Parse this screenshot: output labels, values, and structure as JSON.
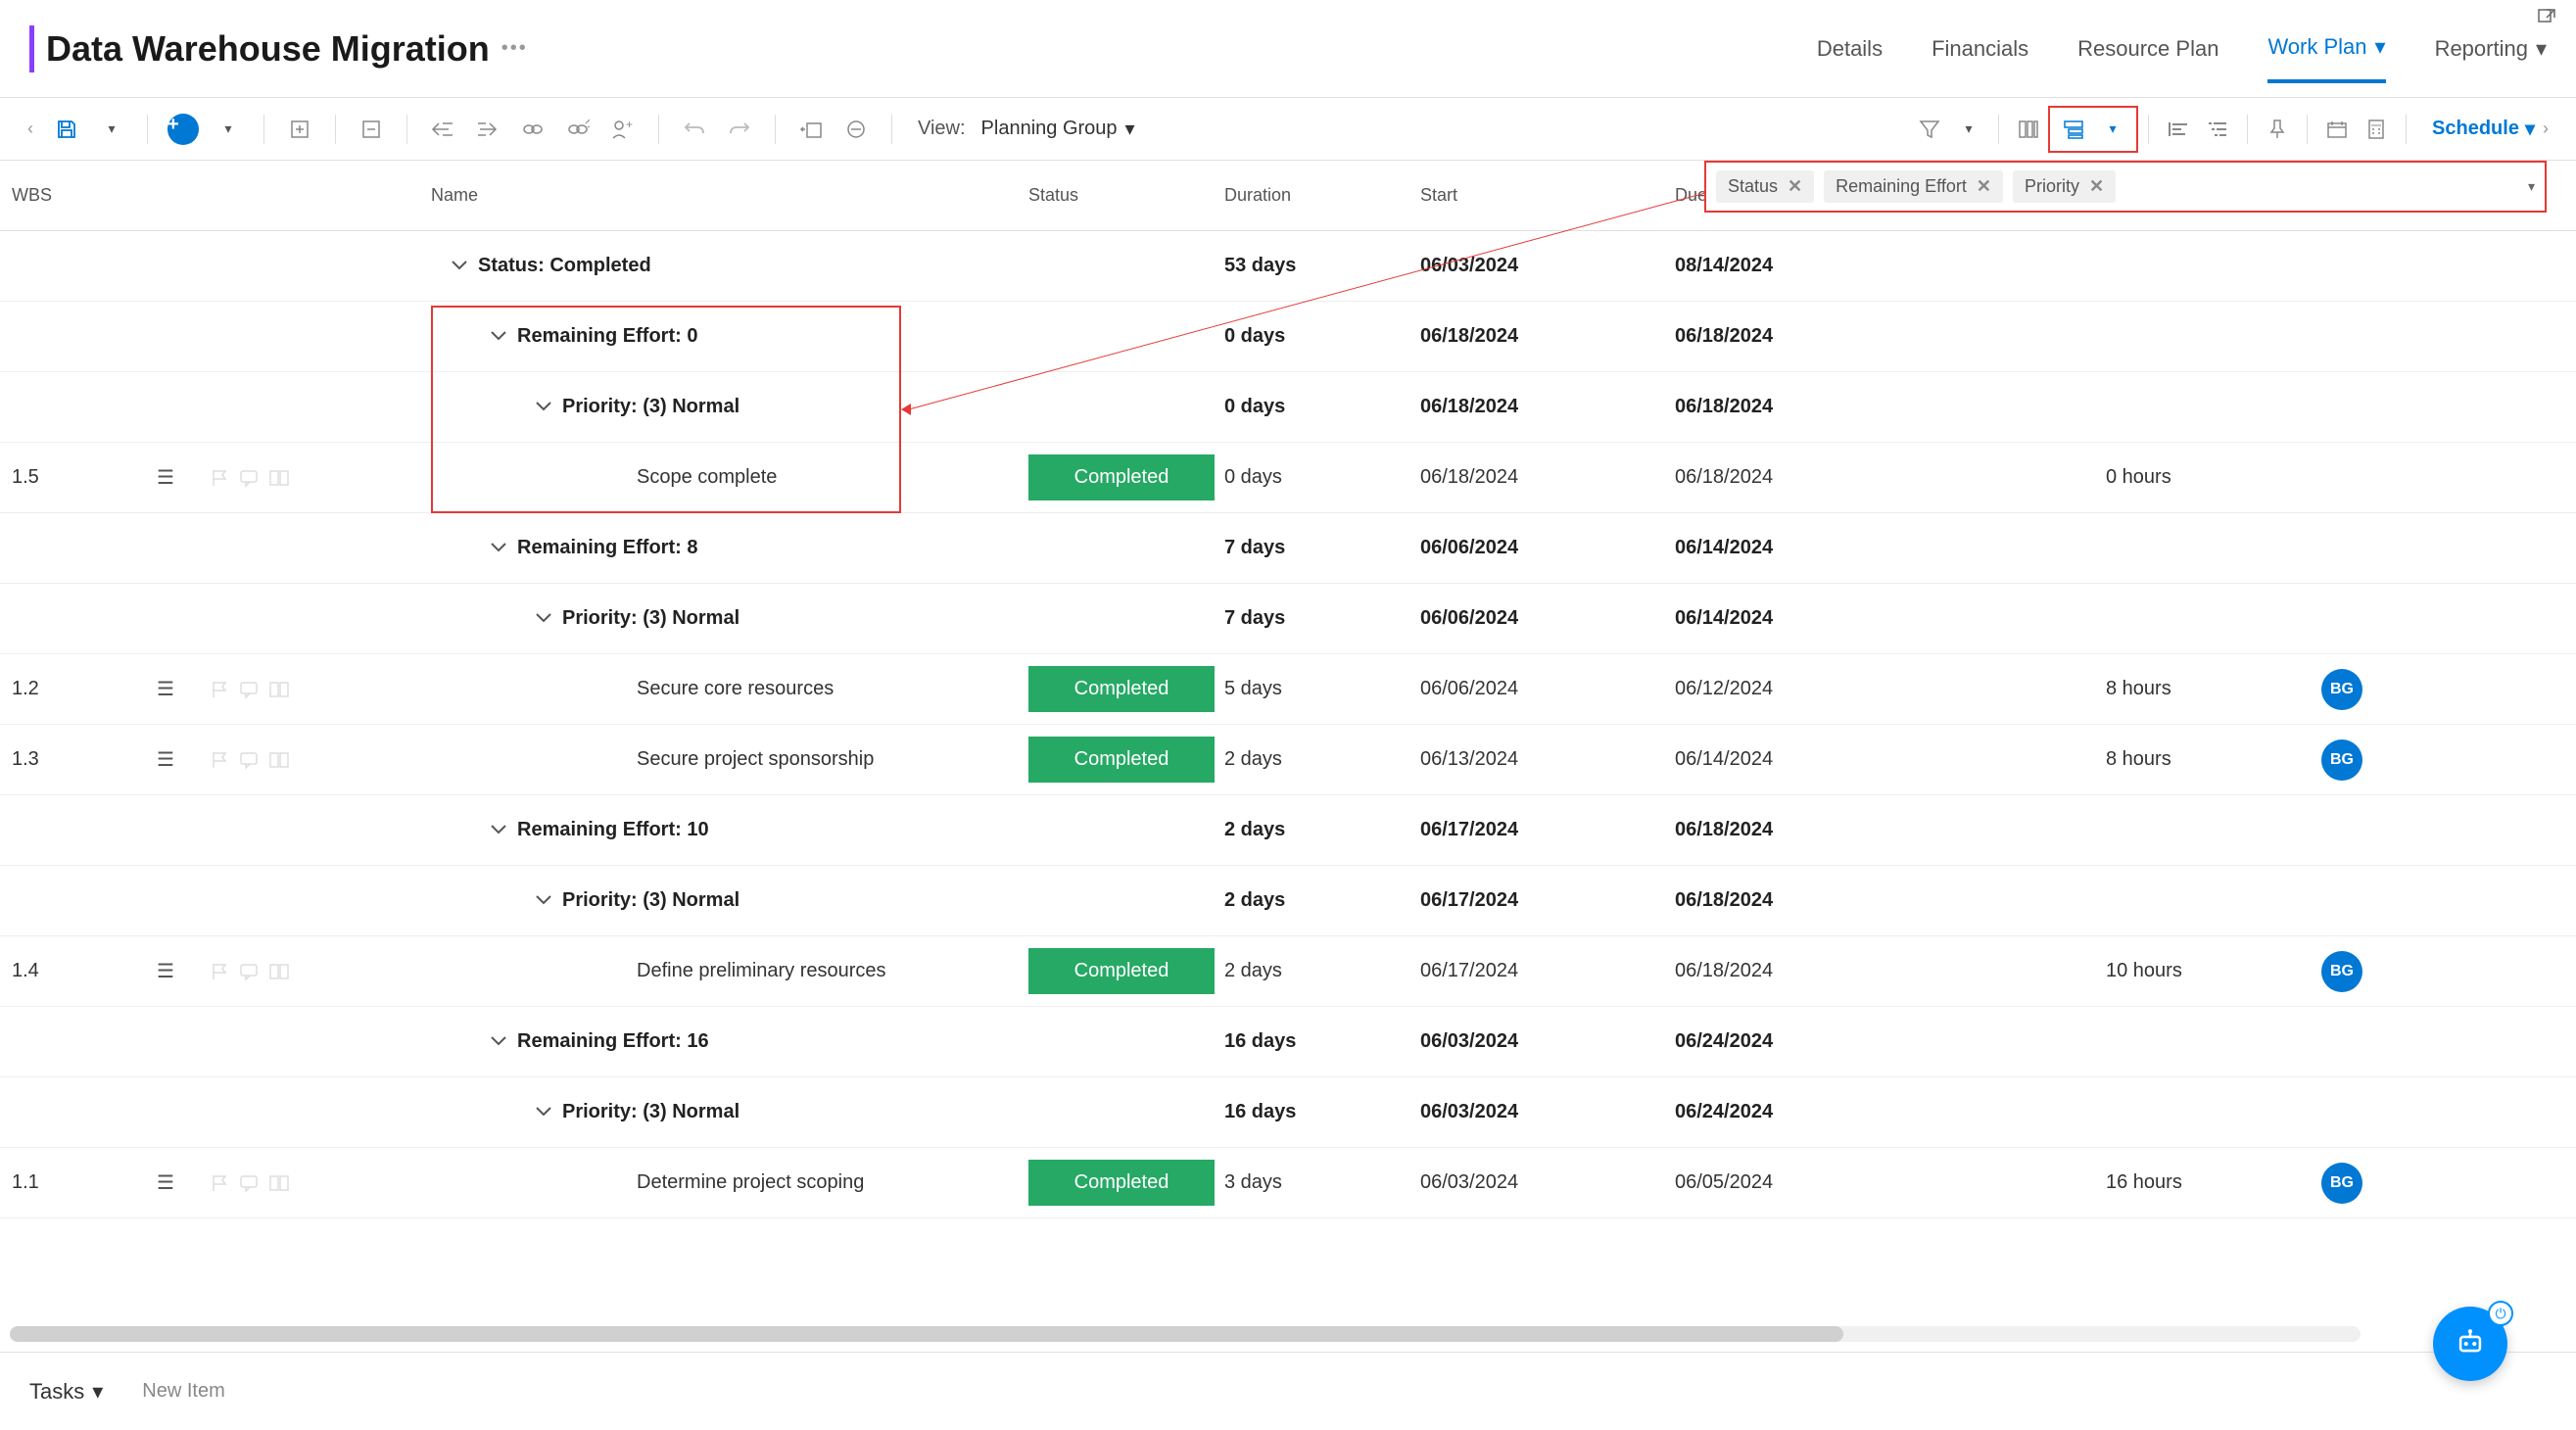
{
  "header": {
    "title": "Data Warehouse Migration",
    "tabs": {
      "details": "Details",
      "financials": "Financials",
      "resource_plan": "Resource Plan",
      "work_plan": "Work Plan",
      "reporting": "Reporting"
    }
  },
  "toolbar": {
    "view_label": "View:",
    "view_value": "Planning Group",
    "schedule": "Schedule"
  },
  "chips": {
    "status": "Status",
    "remaining_effort": "Remaining Effort",
    "priority": "Priority"
  },
  "columns": {
    "wbs": "WBS",
    "name": "Name",
    "status": "Status",
    "duration": "Duration",
    "start": "Start",
    "due": "Due"
  },
  "rows": [
    {
      "type": "group",
      "level": 0,
      "label": "Status: Completed",
      "duration": "53 days",
      "start": "06/03/2024",
      "due": "08/14/2024"
    },
    {
      "type": "group",
      "level": 1,
      "label": "Remaining Effort: 0",
      "duration": "0 days",
      "start": "06/18/2024",
      "due": "06/18/2024"
    },
    {
      "type": "group",
      "level": 2,
      "label": "Priority: (3) Normal",
      "duration": "0 days",
      "start": "06/18/2024",
      "due": "06/18/2024"
    },
    {
      "type": "task",
      "wbs": "1.5",
      "name": "Scope complete",
      "status": "Completed",
      "duration": "0 days",
      "start": "06/18/2024",
      "due": "06/18/2024",
      "effort": "0 hours",
      "avatar": ""
    },
    {
      "type": "group",
      "level": 1,
      "label": "Remaining Effort: 8",
      "duration": "7 days",
      "start": "06/06/2024",
      "due": "06/14/2024"
    },
    {
      "type": "group",
      "level": 2,
      "label": "Priority: (3) Normal",
      "duration": "7 days",
      "start": "06/06/2024",
      "due": "06/14/2024"
    },
    {
      "type": "task",
      "wbs": "1.2",
      "name": "Secure core resources",
      "status": "Completed",
      "duration": "5 days",
      "start": "06/06/2024",
      "due": "06/12/2024",
      "effort": "8 hours",
      "avatar": "BG"
    },
    {
      "type": "task",
      "wbs": "1.3",
      "name": "Secure project sponsorship",
      "status": "Completed",
      "duration": "2 days",
      "start": "06/13/2024",
      "due": "06/14/2024",
      "effort": "8 hours",
      "avatar": "BG"
    },
    {
      "type": "group",
      "level": 1,
      "label": "Remaining Effort: 10",
      "duration": "2 days",
      "start": "06/17/2024",
      "due": "06/18/2024"
    },
    {
      "type": "group",
      "level": 2,
      "label": "Priority: (3) Normal",
      "duration": "2 days",
      "start": "06/17/2024",
      "due": "06/18/2024"
    },
    {
      "type": "task",
      "wbs": "1.4",
      "name": "Define preliminary resources",
      "status": "Completed",
      "duration": "2 days",
      "start": "06/17/2024",
      "due": "06/18/2024",
      "effort": "10 hours",
      "avatar": "BG"
    },
    {
      "type": "group",
      "level": 1,
      "label": "Remaining Effort: 16",
      "duration": "16 days",
      "start": "06/03/2024",
      "due": "06/24/2024"
    },
    {
      "type": "group",
      "level": 2,
      "label": "Priority: (3) Normal",
      "duration": "16 days",
      "start": "06/03/2024",
      "due": "06/24/2024"
    },
    {
      "type": "task",
      "wbs": "1.1",
      "name": "Determine project scoping",
      "status": "Completed",
      "duration": "3 days",
      "start": "06/03/2024",
      "due": "06/05/2024",
      "effort": "16 hours",
      "avatar": "BG"
    }
  ],
  "footer": {
    "tasks": "Tasks",
    "new_item": "New Item"
  }
}
